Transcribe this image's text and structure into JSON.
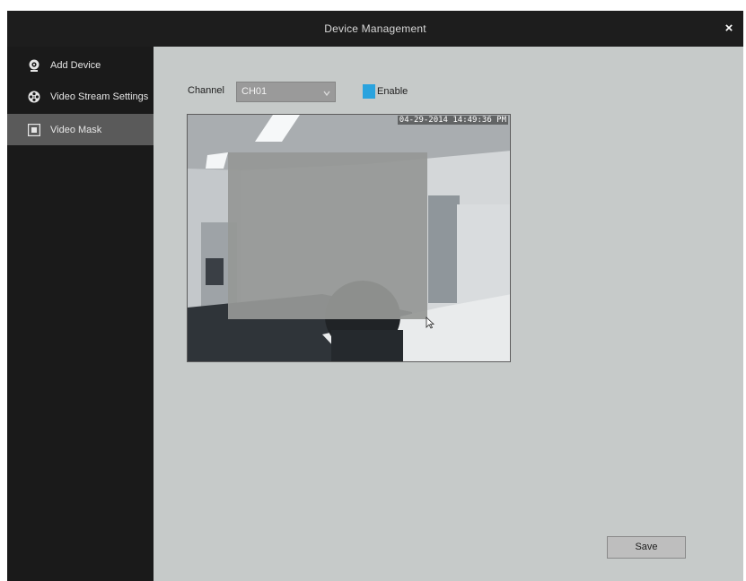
{
  "window": {
    "title": "Device Management",
    "close_label": "×"
  },
  "sidebar": {
    "items": [
      {
        "label": "Add Device",
        "icon": "webcam-icon",
        "active": false
      },
      {
        "label": "Video Stream Settings",
        "icon": "film-reel-icon",
        "active": false
      },
      {
        "label": "Video Mask",
        "icon": "mask-square-icon",
        "active": true
      }
    ]
  },
  "main": {
    "channel_label": "Channel",
    "channel_value": "CH01",
    "enable_label": "Enable",
    "enable_checked": true,
    "video": {
      "timestamp": "04-29-2014 14:49:36 PM"
    },
    "save_label": "Save"
  },
  "colors": {
    "titlebar": "#1d1d1d",
    "sidebar": "#1a1a1a",
    "sidebar_active": "#5a5a5a",
    "panel": "#c6cac9",
    "accent": "#2aa3de"
  }
}
